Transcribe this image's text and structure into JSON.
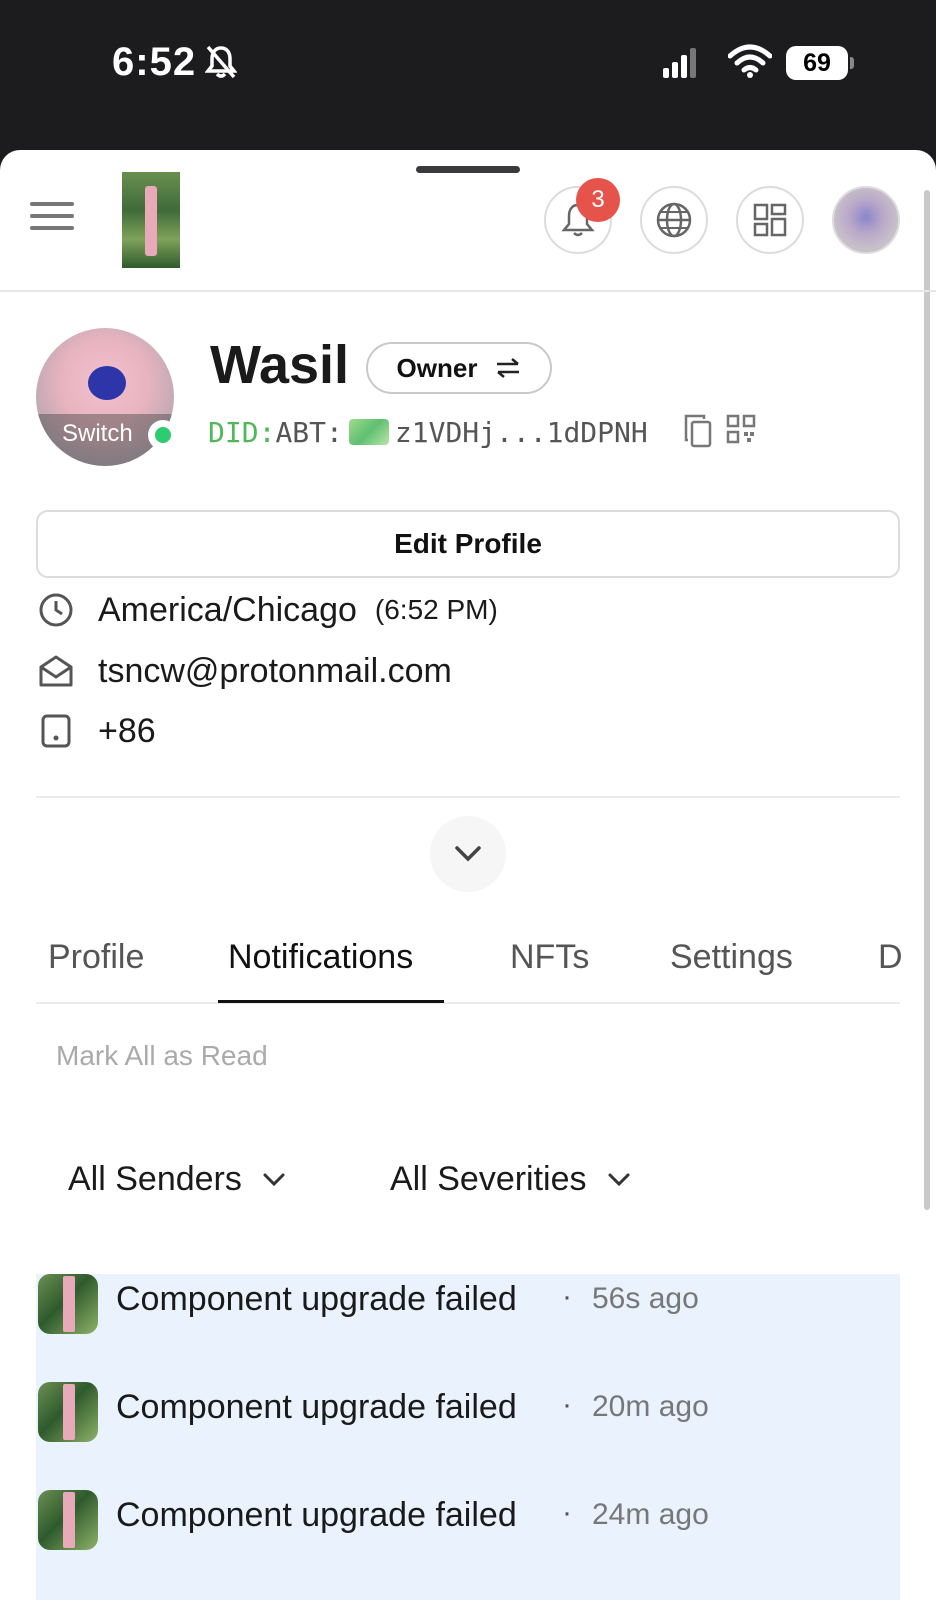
{
  "status_bar": {
    "time": "6:52",
    "battery": "69"
  },
  "header": {
    "notification_count": "3"
  },
  "profile": {
    "avatar_label": "Switch",
    "name": "Wasil",
    "role": "Owner",
    "did_prefix": "DID:",
    "did_type": "ABT:",
    "did_value": "z1VDHj...1dDPNH",
    "edit_label": "Edit Profile",
    "timezone": "America/Chicago",
    "local_time": "(6:52 PM)",
    "email": "tsncw@protonmail.com",
    "phone": "+86"
  },
  "tabs": [
    "Profile",
    "Notifications",
    "NFTs",
    "Settings",
    "D"
  ],
  "active_tab": "Notifications",
  "notifications": {
    "mark_all_label": "Mark All as Read",
    "senders_filter": "All Senders",
    "severities_filter": "All Severities",
    "items": [
      {
        "title": "Component upgrade failed",
        "separator": "·",
        "time": "56s ago"
      },
      {
        "title": "Component upgrade failed",
        "separator": "·",
        "time": "20m ago"
      },
      {
        "title": "Component upgrade failed",
        "separator": "·",
        "time": "24m ago"
      }
    ]
  },
  "colors": {
    "badge": "#e5534b",
    "online": "#2ecc71",
    "did_green": "#4fb85a",
    "unread_bg": "#eaf2fd"
  },
  "icons": [
    "bell-off-icon",
    "signal-icon",
    "wifi-icon",
    "menu-icon",
    "bell-icon",
    "globe-icon",
    "apps-icon",
    "copy-icon",
    "qr-icon",
    "clock-icon",
    "mail-icon",
    "phone-icon",
    "swap-icon",
    "chevron-down-icon"
  ]
}
